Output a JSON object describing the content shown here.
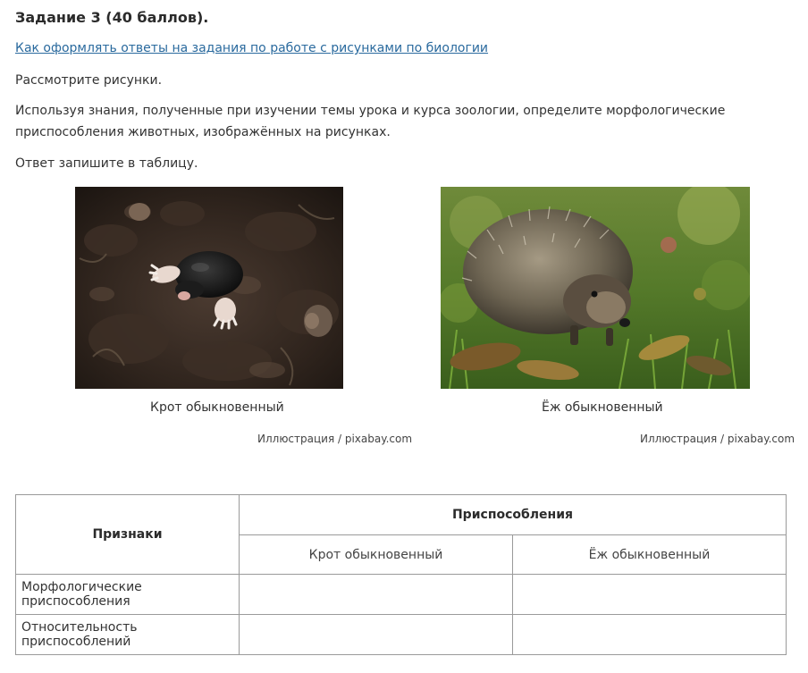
{
  "task": {
    "title": "Задание 3 (40 баллов).",
    "guide_link": "Как оформлять ответы на задания по работе с рисунками по биологии",
    "paragraphs": [
      "Рассмотрите рисунки.",
      "Используя знания, полученные при изучении темы урока и курса зоологии, определите морфологические приспособления животных, изображённых на рисунках.",
      "Ответ запишите в таблицу."
    ]
  },
  "figures": [
    {
      "caption": "Крот обыкновенный",
      "credit": "Иллюстрация / pixabay.com"
    },
    {
      "caption": "Ёж обыкновенный",
      "credit": "Иллюстрация / pixabay.com"
    }
  ],
  "table": {
    "header_features": "Признаки",
    "header_adaptations": "Приспособления",
    "subheaders": [
      "Крот обыкновенный",
      "Ёж обыкновенный"
    ],
    "rows": [
      {
        "label": "Морфологические приспособления",
        "values": [
          "",
          ""
        ]
      },
      {
        "label": "Относительность приспособлений",
        "values": [
          "",
          ""
        ]
      }
    ]
  },
  "colors": {
    "link": "#2a6a9e",
    "border": "#9a9a9a",
    "text": "#333333"
  }
}
